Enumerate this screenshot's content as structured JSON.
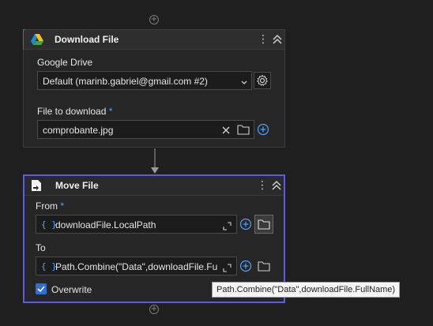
{
  "download_card": {
    "title": "Download File",
    "google_drive_label": "Google Drive",
    "account_value": "Default (marinb.gabriel@gmail.com #2)",
    "file_label": "File to download",
    "required_mark": "*",
    "file_value": "comprobante.jpg"
  },
  "move_card": {
    "title": "Move File",
    "from_label": "From",
    "required_mark": "*",
    "from_value": "downloadFile.LocalPath",
    "to_label": "To",
    "to_value": "Path.Combine(\"Data\",downloadFile.Fu",
    "overwrite_label": "Overwrite",
    "overwrite_checked": true,
    "expression_glyph": "{ }"
  },
  "tooltip": {
    "text": "Path.Combine(\"Data\",downloadFile.FullName)"
  },
  "colors": {
    "accent_blue": "#5b5be8",
    "link_blue": "#4ea3ff",
    "card_bg": "#262626",
    "page_bg": "#1f1f1f",
    "drive_accent": "#2a8a4a"
  },
  "icons": [
    "plus-icon",
    "google-drive-icon",
    "kebab-menu-icon",
    "collapse-icon",
    "settings-icon",
    "clear-icon",
    "folder-icon",
    "add-circle-icon",
    "expression-icon",
    "expand-icon",
    "move-file-icon",
    "checkbox-icon"
  ]
}
